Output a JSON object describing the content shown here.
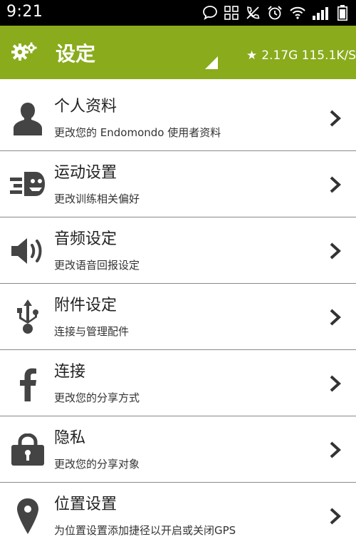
{
  "status_bar": {
    "time": "9:21",
    "icons": [
      "chat-bubble-icon",
      "apps-grid-icon",
      "missed-call-icon",
      "alarm-icon",
      "wifi-icon",
      "signal-icon",
      "battery-icon"
    ]
  },
  "action_bar": {
    "title": "设定",
    "speed": "2.17G  115.1K/S",
    "brand_color": "#8aab1c"
  },
  "settings": [
    {
      "title": "个人资料",
      "subtitle": "更改您的 Endomondo 使用者资料",
      "icon": "person-icon"
    },
    {
      "title": "运动设置",
      "subtitle": "更改训练相关偏好",
      "icon": "endomondo-icon"
    },
    {
      "title": "音频设定",
      "subtitle": "更改语音回报设定",
      "icon": "speaker-icon"
    },
    {
      "title": "附件设定",
      "subtitle": "连接与管理配件",
      "icon": "usb-icon"
    },
    {
      "title": "连接",
      "subtitle": "更改您的分享方式",
      "icon": "facebook-icon"
    },
    {
      "title": "隐私",
      "subtitle": "更改您的分享对象",
      "icon": "lock-icon"
    },
    {
      "title": "位置设置",
      "subtitle": "为位置设置添加捷径以开启或关闭GPS",
      "icon": "location-pin-icon"
    }
  ]
}
